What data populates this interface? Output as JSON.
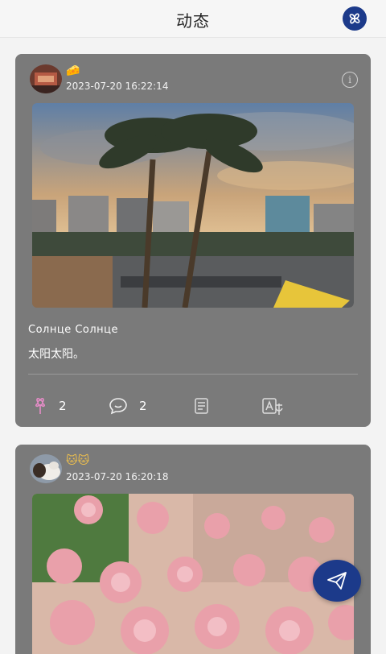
{
  "header": {
    "title": "动态",
    "action_icon": "pinwheel-icon"
  },
  "posts": [
    {
      "badge": "🧀",
      "timestamp": "2023-07-20 16:22:14",
      "title": "Солнце  Солнце",
      "text": "太阳太阳。",
      "likes": "2",
      "comments": "2",
      "image_desc": "palm-trees-city-sunset-photo"
    },
    {
      "badge": "🐱🐱",
      "timestamp": "2023-07-20 16:20:18",
      "image_desc": "pink-roses-photo"
    }
  ],
  "colors": {
    "accent": "#1c3a8a",
    "card": "#7a7a7a",
    "background": "#f3f3f3",
    "like": "#e58cc7"
  }
}
